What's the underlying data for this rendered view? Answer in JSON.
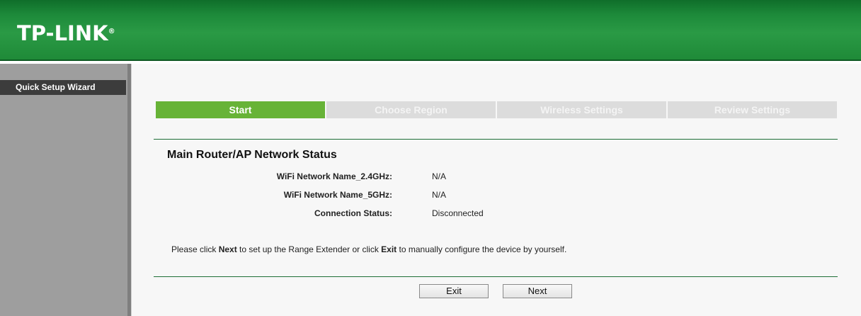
{
  "header": {
    "logo_text": "TP-LINK",
    "logo_mark": "®"
  },
  "sidebar": {
    "items": [
      {
        "label": "Quick Setup Wizard"
      }
    ]
  },
  "wizard": {
    "steps": [
      {
        "label": "Start",
        "active": true
      },
      {
        "label": "Choose Region",
        "active": false
      },
      {
        "label": "Wireless Settings",
        "active": false
      },
      {
        "label": "Review Settings",
        "active": false
      }
    ]
  },
  "status": {
    "title": "Main Router/AP Network Status",
    "rows": [
      {
        "label": "WiFi Network Name_2.4GHz:",
        "value": "N/A"
      },
      {
        "label": "WiFi Network Name_5GHz:",
        "value": "N/A"
      },
      {
        "label": "Connection Status:",
        "value": "Disconnected"
      }
    ]
  },
  "instruction": {
    "part1": "Please click ",
    "next_word": "Next",
    "part2": " to set up the Range Extender or click ",
    "exit_word": "Exit",
    "part3": " to manually configure the device by yourself."
  },
  "buttons": {
    "exit_label": "Exit",
    "next_label": "Next"
  },
  "colors": {
    "header_green": "#1d8a3a",
    "active_step": "#67b337",
    "inactive_step": "#dcdcdc",
    "sidebar_bg": "#9e9e9e",
    "sidebar_active": "#3c3c3c"
  }
}
